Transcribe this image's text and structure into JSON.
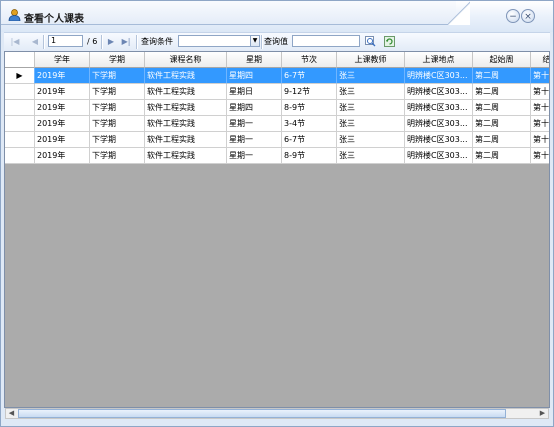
{
  "window": {
    "title": "查看个人课表",
    "buttons": {
      "minimize": "−",
      "close": "×"
    }
  },
  "toolbar": {
    "first_icon": "first-page-icon",
    "prev_icon": "prev-page-icon",
    "current_page": "1",
    "total_pages": "/ 6",
    "next_icon": "next-page-icon",
    "last_icon": "last-page-icon",
    "query_condition_label": "查询条件",
    "query_condition_value": "",
    "query_value_label": "查询值",
    "query_value_input": "",
    "search_icon": "search-icon",
    "refresh_icon": "refresh-icon"
  },
  "grid": {
    "columns": [
      "学年",
      "学期",
      "课程名称",
      "星期",
      "节次",
      "上课教师",
      "上课地点",
      "起始周",
      "结束"
    ],
    "selected_row": 0,
    "rows": [
      [
        "2019年",
        "下学期",
        "软件工程实践",
        "星期四",
        "6-7节",
        "张三",
        "明辨楼C区303...",
        "第二周",
        "第十八"
      ],
      [
        "2019年",
        "下学期",
        "软件工程实践",
        "星期日",
        "9-12节",
        "张三",
        "明辨楼C区303...",
        "第二周",
        "第十八"
      ],
      [
        "2019年",
        "下学期",
        "软件工程实践",
        "星期四",
        "8-9节",
        "张三",
        "明辨楼C区303...",
        "第二周",
        "第十八"
      ],
      [
        "2019年",
        "下学期",
        "软件工程实践",
        "星期一",
        "3-4节",
        "张三",
        "明辨楼C区303...",
        "第二周",
        "第十八"
      ],
      [
        "2019年",
        "下学期",
        "软件工程实践",
        "星期一",
        "6-7节",
        "张三",
        "明辨楼C区303...",
        "第二周",
        "第十八"
      ],
      [
        "2019年",
        "下学期",
        "软件工程实践",
        "星期一",
        "8-9节",
        "张三",
        "明辨楼C区303...",
        "第二周",
        "第十八"
      ]
    ],
    "row_indicator": "▶"
  },
  "scrollbar": {
    "left_arrow": "◀",
    "right_arrow": "▶"
  },
  "colors": {
    "selection": "#3399ff",
    "empty_area": "#ababab",
    "frame": "#dfe9f6"
  }
}
